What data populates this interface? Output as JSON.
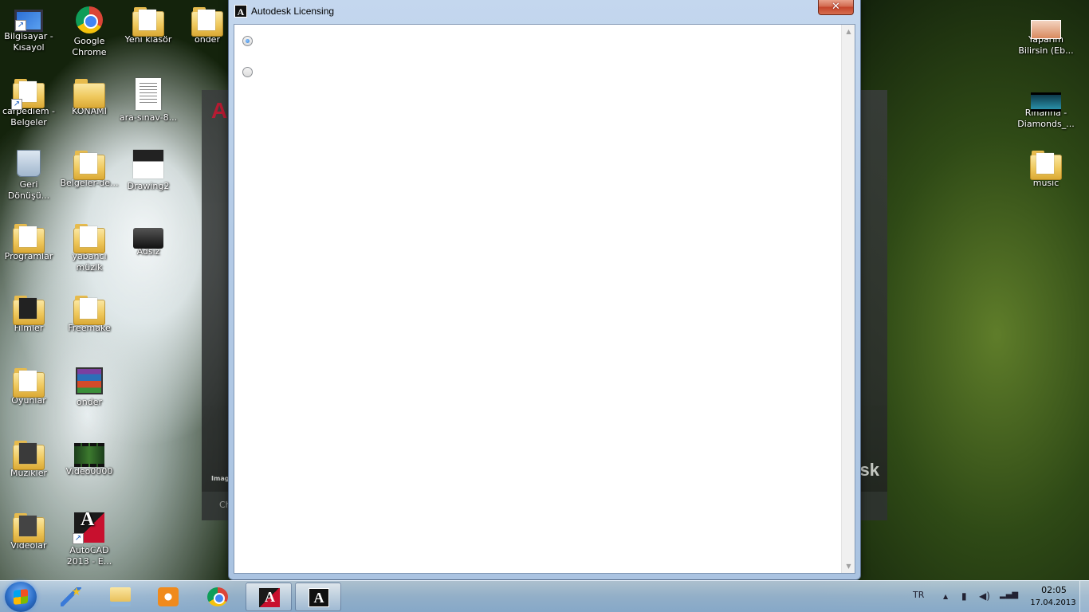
{
  "desktop": {
    "icons_left": [
      {
        "label": "Bilgisayar - Kısayol",
        "glyph": "computer-icon"
      },
      {
        "label": "Google Chrome",
        "glyph": "chrome-icon"
      },
      {
        "label": "Yeni klasör",
        "glyph": "folder-icon"
      },
      {
        "label": "onder",
        "glyph": "folder-icon"
      },
      {
        "label": "carpediem - Belgeler",
        "glyph": "folder-shortcut-icon"
      },
      {
        "label": "KONAMI",
        "glyph": "folder-icon"
      },
      {
        "label": "ara-sınav-8...",
        "glyph": "document-icon"
      },
      {
        "label": "Geri Dönüşü...",
        "glyph": "recycle-bin-icon"
      },
      {
        "label": "Belgeler-de...",
        "glyph": "folder-icon"
      },
      {
        "label": "Drawing2",
        "glyph": "drawing-icon"
      },
      {
        "label": "Programlar",
        "glyph": "folder-icon"
      },
      {
        "label": "yabancı müzik",
        "glyph": "folder-icon"
      },
      {
        "label": "Adsız",
        "glyph": "camera-icon"
      },
      {
        "label": "Filmler",
        "glyph": "folder-icon"
      },
      {
        "label": "Freemake",
        "glyph": "folder-icon"
      },
      {
        "label": "Oyunlar",
        "glyph": "folder-icon"
      },
      {
        "label": "onder",
        "glyph": "winrar-icon"
      },
      {
        "label": "Müzikler",
        "glyph": "folder-icon"
      },
      {
        "label": "Video0000",
        "glyph": "video-icon"
      },
      {
        "label": "Videolar",
        "glyph": "folder-icon"
      },
      {
        "label": "AutoCAD 2013 - E...",
        "glyph": "autocad-icon"
      }
    ],
    "icons_right": [
      {
        "label": "Yaparım Bilirsin (Eb...",
        "glyph": "image-icon"
      },
      {
        "label": "Rihanna - Diamonds_...",
        "glyph": "film-icon"
      },
      {
        "label": "music",
        "glyph": "folder-icon"
      }
    ]
  },
  "background_window": {
    "logo_letter": "A",
    "brand_text": "sk",
    "image_label": "Imag",
    "bottom_text": "Ch"
  },
  "dialog": {
    "title": "Autodesk Licensing",
    "app_icon_letter": "A",
    "close_symbol": "✕",
    "radio_options": [
      {
        "checked": true
      },
      {
        "checked": false
      }
    ],
    "scroll_up_symbol": "▲",
    "scroll_down_symbol": "▼"
  },
  "taskbar": {
    "pinned": [
      {
        "name": "wizard-icon",
        "active": false
      },
      {
        "name": "explorer-icon",
        "active": false
      },
      {
        "name": "media-player-icon",
        "active": false
      },
      {
        "name": "chrome-icon",
        "active": false
      },
      {
        "name": "autocad-icon",
        "active": true
      },
      {
        "name": "autodesk-licensing-icon",
        "active": true
      }
    ],
    "tray": {
      "language": "TR",
      "expand_symbol": "▲",
      "time": "02:05",
      "date": "17.04.2013"
    }
  },
  "colors": {
    "titlebar": "#b4cbe6",
    "close_button": "#c4442a",
    "taskbar": "#a0bedc"
  }
}
